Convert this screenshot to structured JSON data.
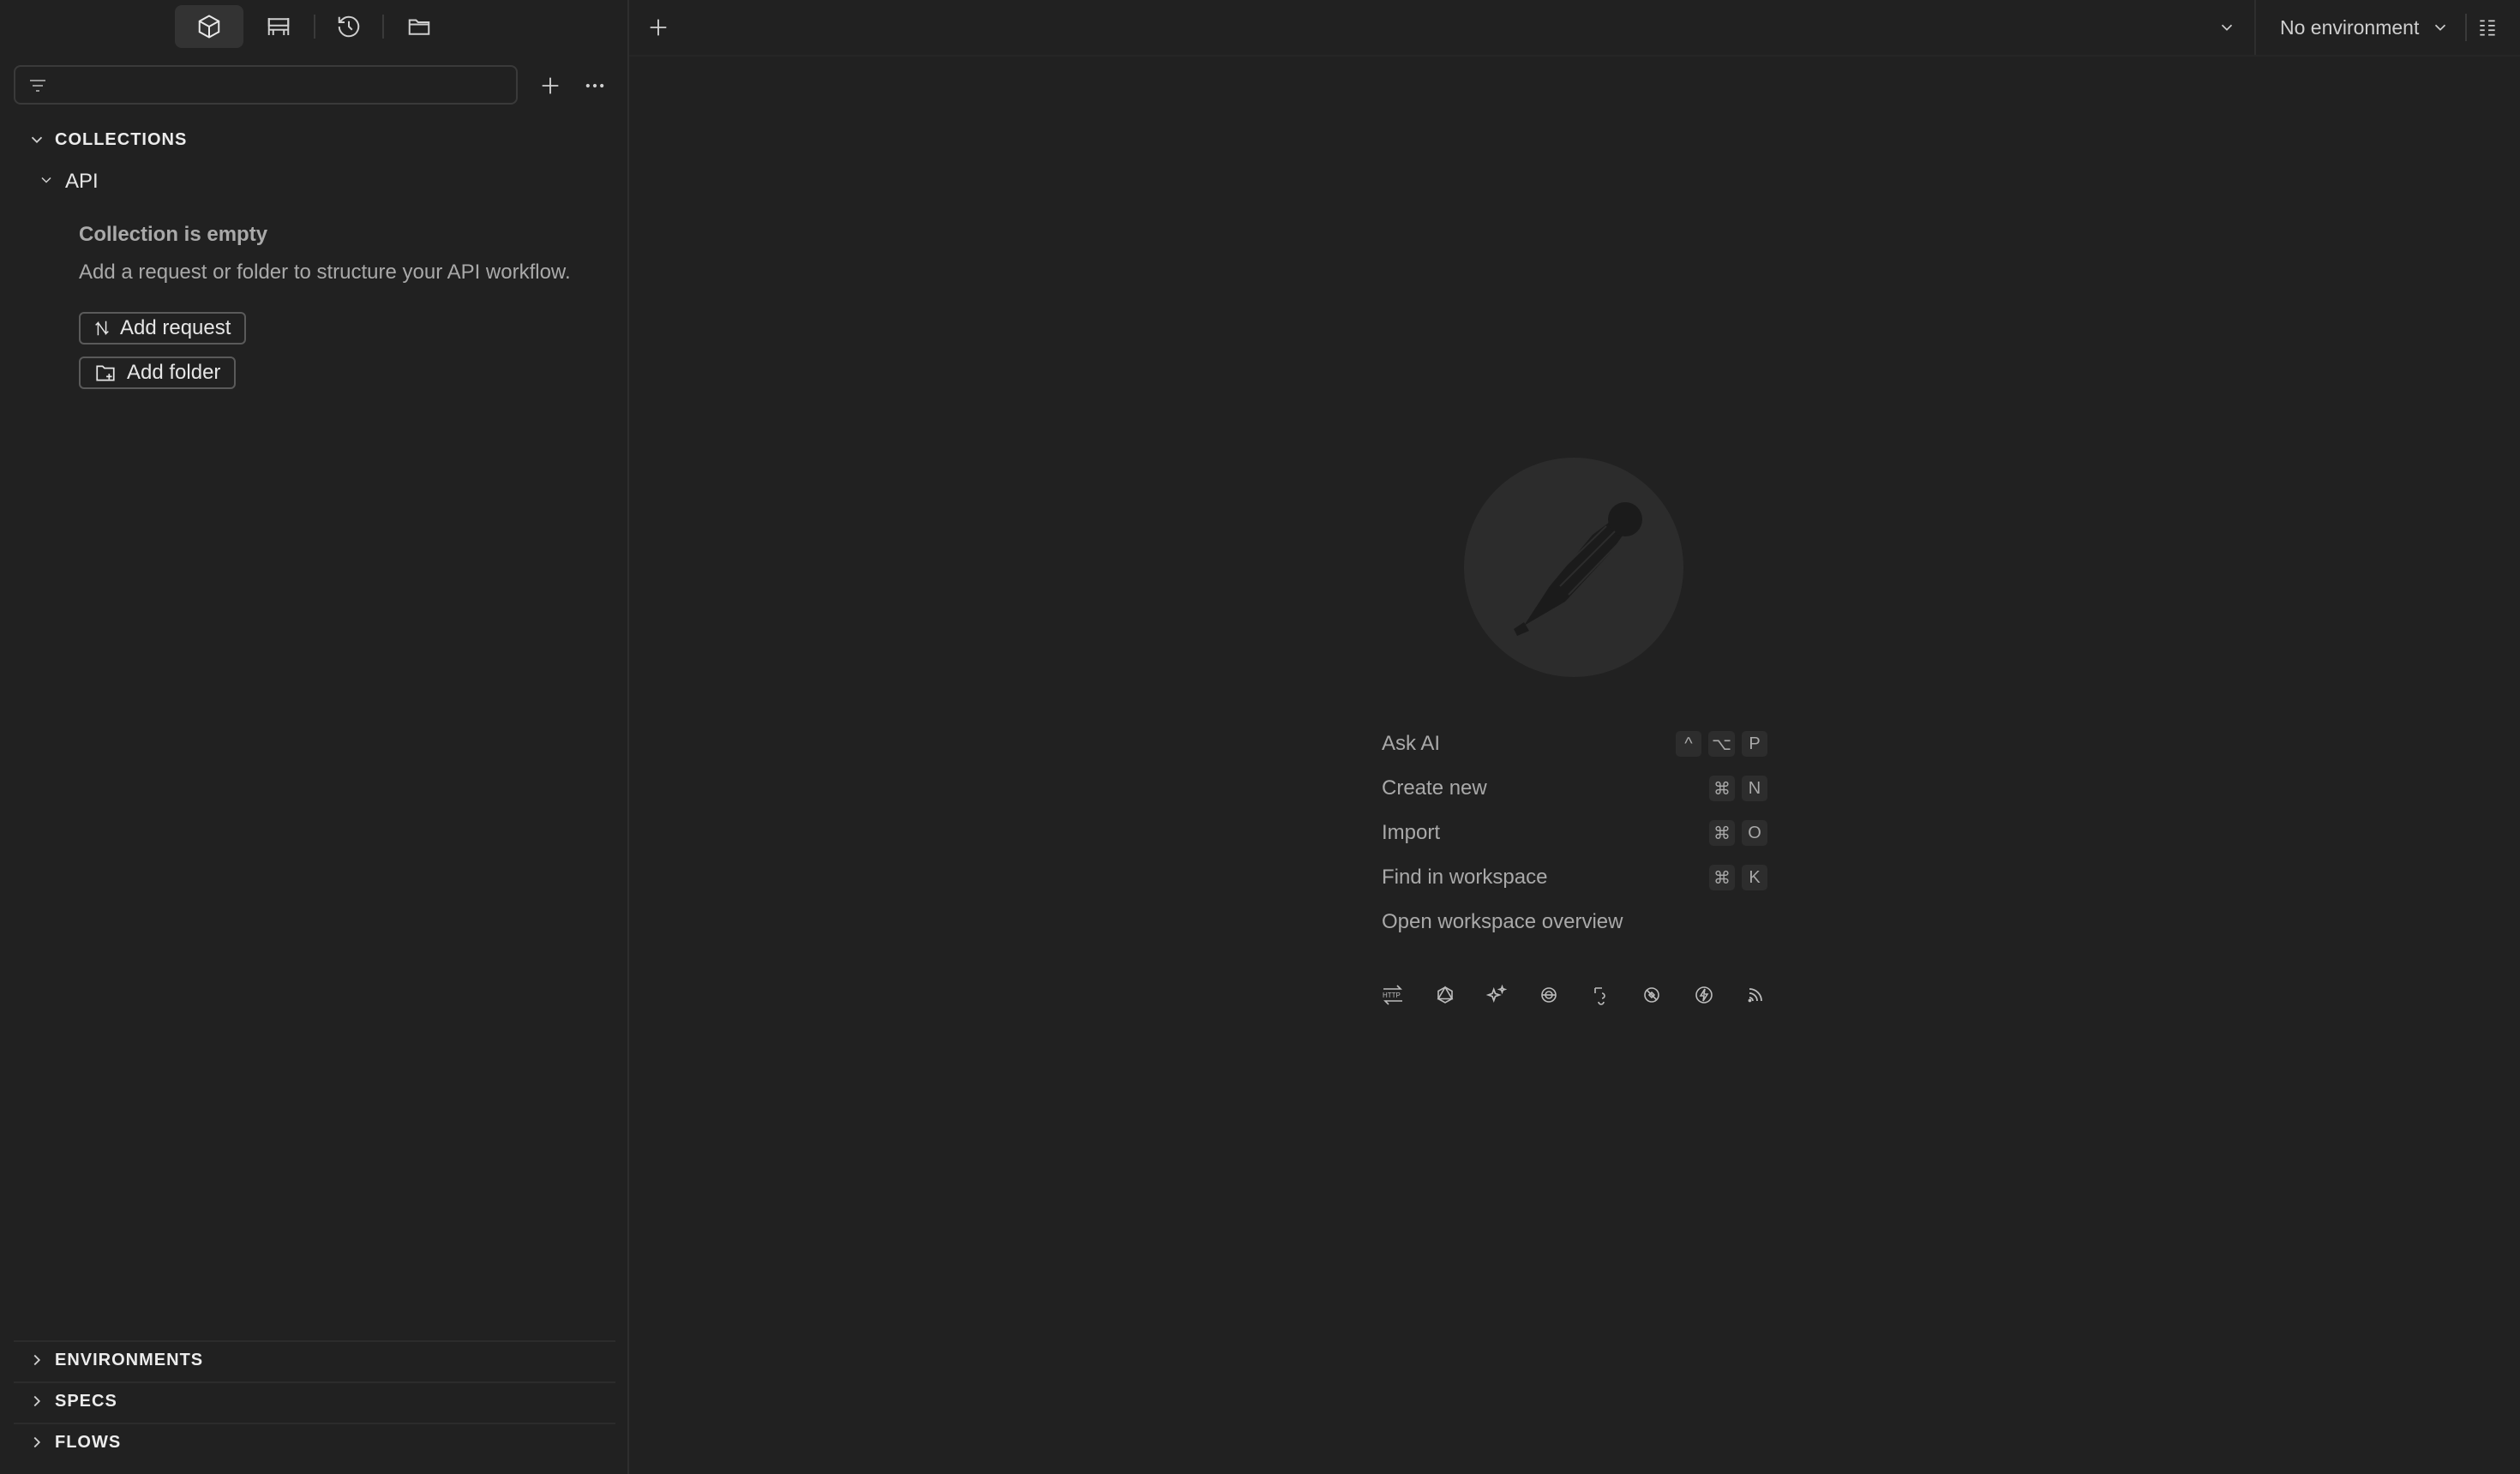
{
  "sidebar": {
    "filter": {
      "placeholder": "",
      "value": ""
    },
    "collections": {
      "title": "COLLECTIONS",
      "items": [
        {
          "name": "API",
          "empty_title": "Collection is empty",
          "empty_desc": "Add a request or folder to structure your API workflow.",
          "add_request_label": "Add request",
          "add_folder_label": "Add folder"
        }
      ]
    },
    "bottom_sections": [
      "ENVIRONMENTS",
      "SPECS",
      "FLOWS"
    ]
  },
  "topbar": {
    "environment_label": "No environment"
  },
  "launchpad": {
    "menu": [
      {
        "label": "Ask AI",
        "keys": [
          "^",
          "⌥",
          "P"
        ]
      },
      {
        "label": "Create new",
        "keys": [
          "⌘",
          "N"
        ]
      },
      {
        "label": "Import",
        "keys": [
          "⌘",
          "O"
        ]
      },
      {
        "label": "Find in workspace",
        "keys": [
          "⌘",
          "K"
        ]
      },
      {
        "label": "Open workspace overview",
        "keys": []
      }
    ],
    "protocol_icons": [
      "http-icon",
      "graphql-icon",
      "ai-sparkle-icon",
      "grpc-icon",
      "websocket-icon",
      "socketio-icon",
      "mqtt-icon",
      "rss-icon"
    ]
  },
  "colors": {
    "background": "#212121",
    "text": "#c9c9c9",
    "accent_active": "#333333"
  }
}
